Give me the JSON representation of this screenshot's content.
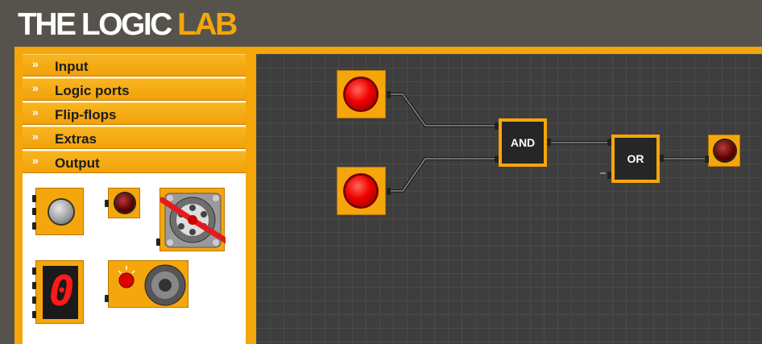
{
  "app": {
    "title_main": "THE LOGIC ",
    "title_accent": "LAB"
  },
  "menu": [
    {
      "label": "Input"
    },
    {
      "label": "Logic ports"
    },
    {
      "label": "Flip-flops"
    },
    {
      "label": "Extras"
    },
    {
      "label": "Output"
    }
  ],
  "palette": {
    "seven_segment_digit": "0",
    "items": [
      "grey-lamp",
      "led",
      "motor-fan",
      "seven-segment-display",
      "buzzer-speaker"
    ]
  },
  "circuit": {
    "gates": [
      {
        "label": "AND"
      },
      {
        "label": "OR"
      }
    ]
  },
  "colors": {
    "accent": "#f5a60a",
    "header": "#55534c",
    "canvas": "#3e3e3e"
  }
}
